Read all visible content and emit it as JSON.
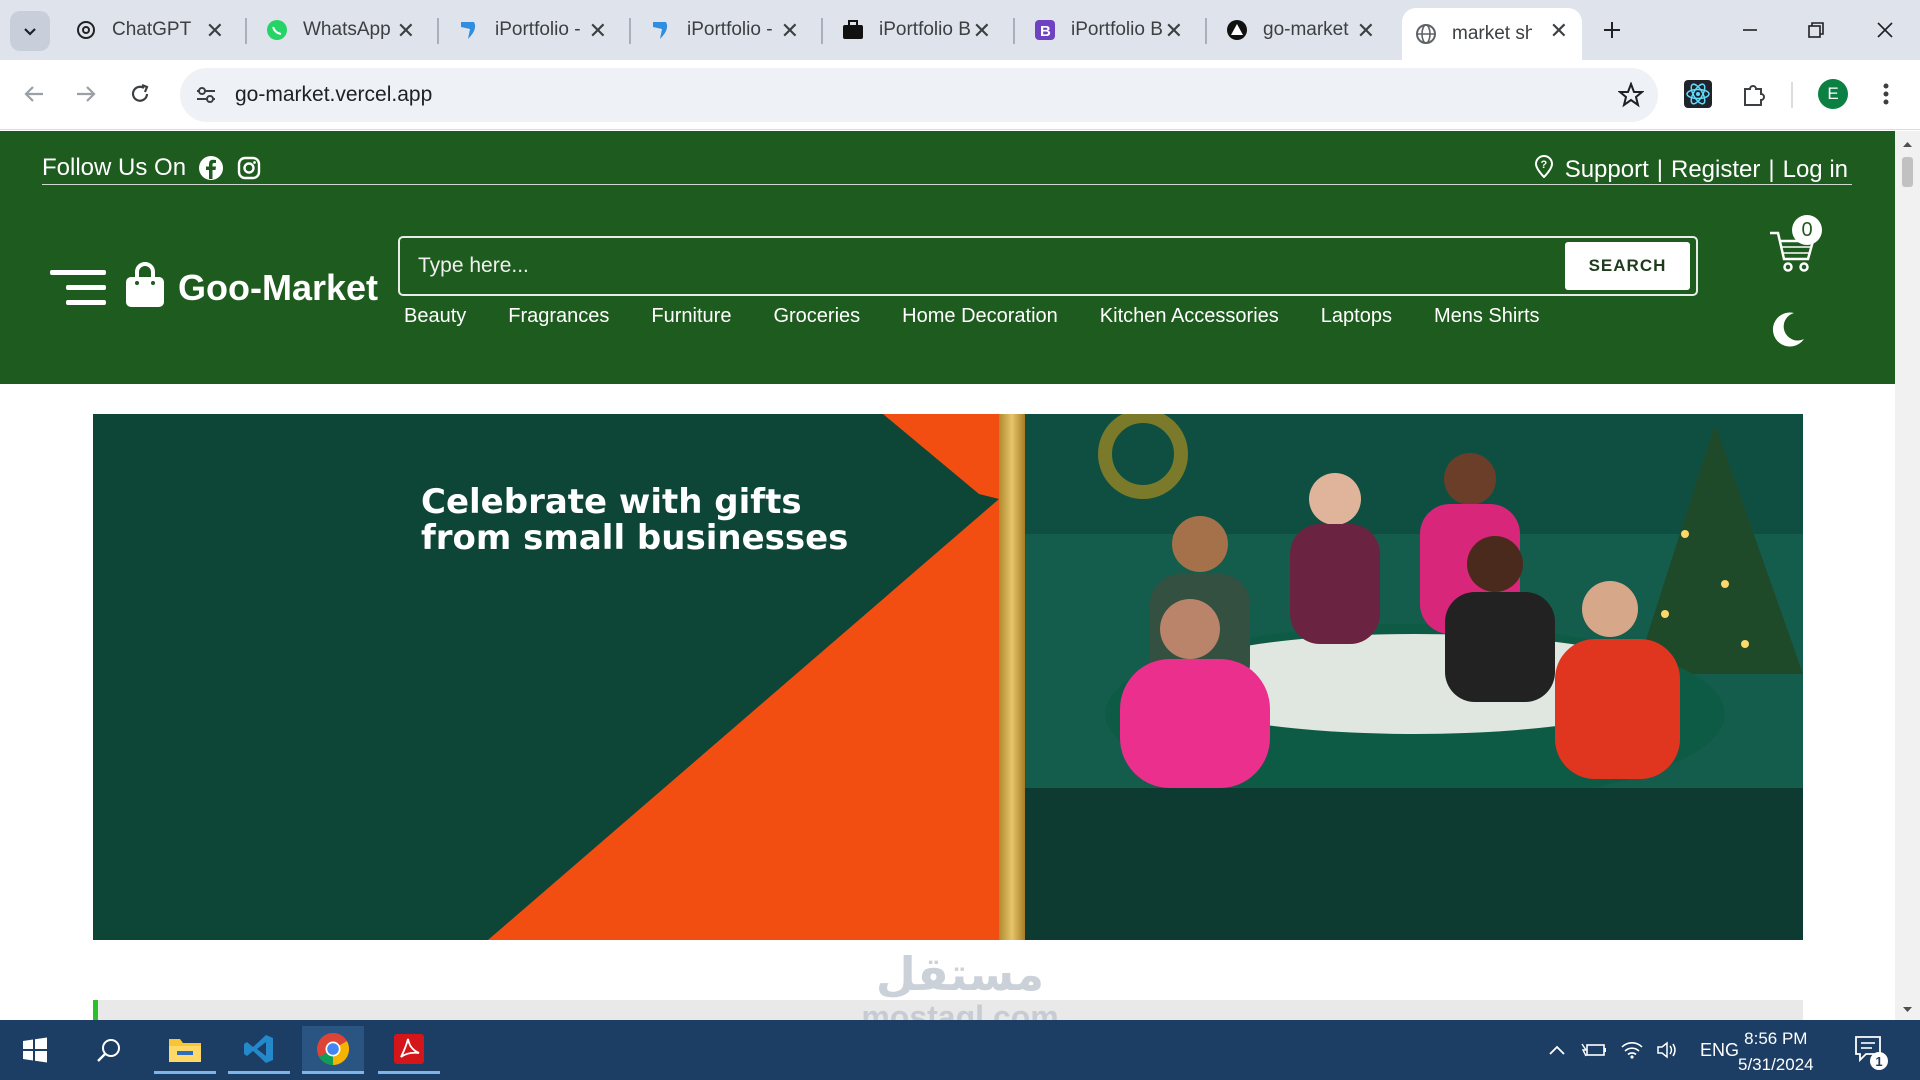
{
  "browser": {
    "tabs": [
      {
        "title": "ChatGPT",
        "icon": "openai-icon"
      },
      {
        "title": "WhatsApp",
        "icon": "whatsapp-icon"
      },
      {
        "title": "iPortfolio -",
        "icon": "bootstrapmade-icon"
      },
      {
        "title": "iPortfolio -",
        "icon": "bootstrapmade-icon"
      },
      {
        "title": "iPortfolio B",
        "icon": "briefcase-icon"
      },
      {
        "title": "iPortfolio B",
        "icon": "bootstrap-icon"
      },
      {
        "title": "go-market",
        "icon": "vercel-icon"
      },
      {
        "title": "market sho",
        "icon": "globe-icon",
        "active": true
      }
    ],
    "url": "go-market.vercel.app",
    "profile_initial": "E"
  },
  "site": {
    "follow_label": "Follow Us On",
    "support": "Support",
    "separator": "|",
    "register": "Register",
    "login": "Log in",
    "brand": "Goo-Market",
    "search_placeholder": "Type here...",
    "search_button": "SEARCH",
    "cart_count": "0",
    "categories": [
      "Beauty",
      "Fragrances",
      "Furniture",
      "Groceries",
      "Home Decoration",
      "Kitchen Accessories",
      "Laptops",
      "Mens Shirts"
    ],
    "colors": {
      "header": "#1e5b1e",
      "banner_dark": "#0d4537",
      "banner_orange": "#f24e12"
    }
  },
  "banner": {
    "heading_line1": "Celebrate with gifts",
    "heading_line2": "from small businesses"
  },
  "carousel_progress": 0.003,
  "watermark": {
    "arabic": "مستقل",
    "latin": "mostaql.com"
  },
  "taskbar": {
    "apps": [
      "windows-start-icon",
      "search-icon",
      "file-explorer-icon",
      "vscode-icon",
      "chrome-icon",
      "acrobat-icon"
    ],
    "lang": "ENG",
    "time": "8:56 PM",
    "date": "5/31/2024",
    "notification_count": "1"
  }
}
